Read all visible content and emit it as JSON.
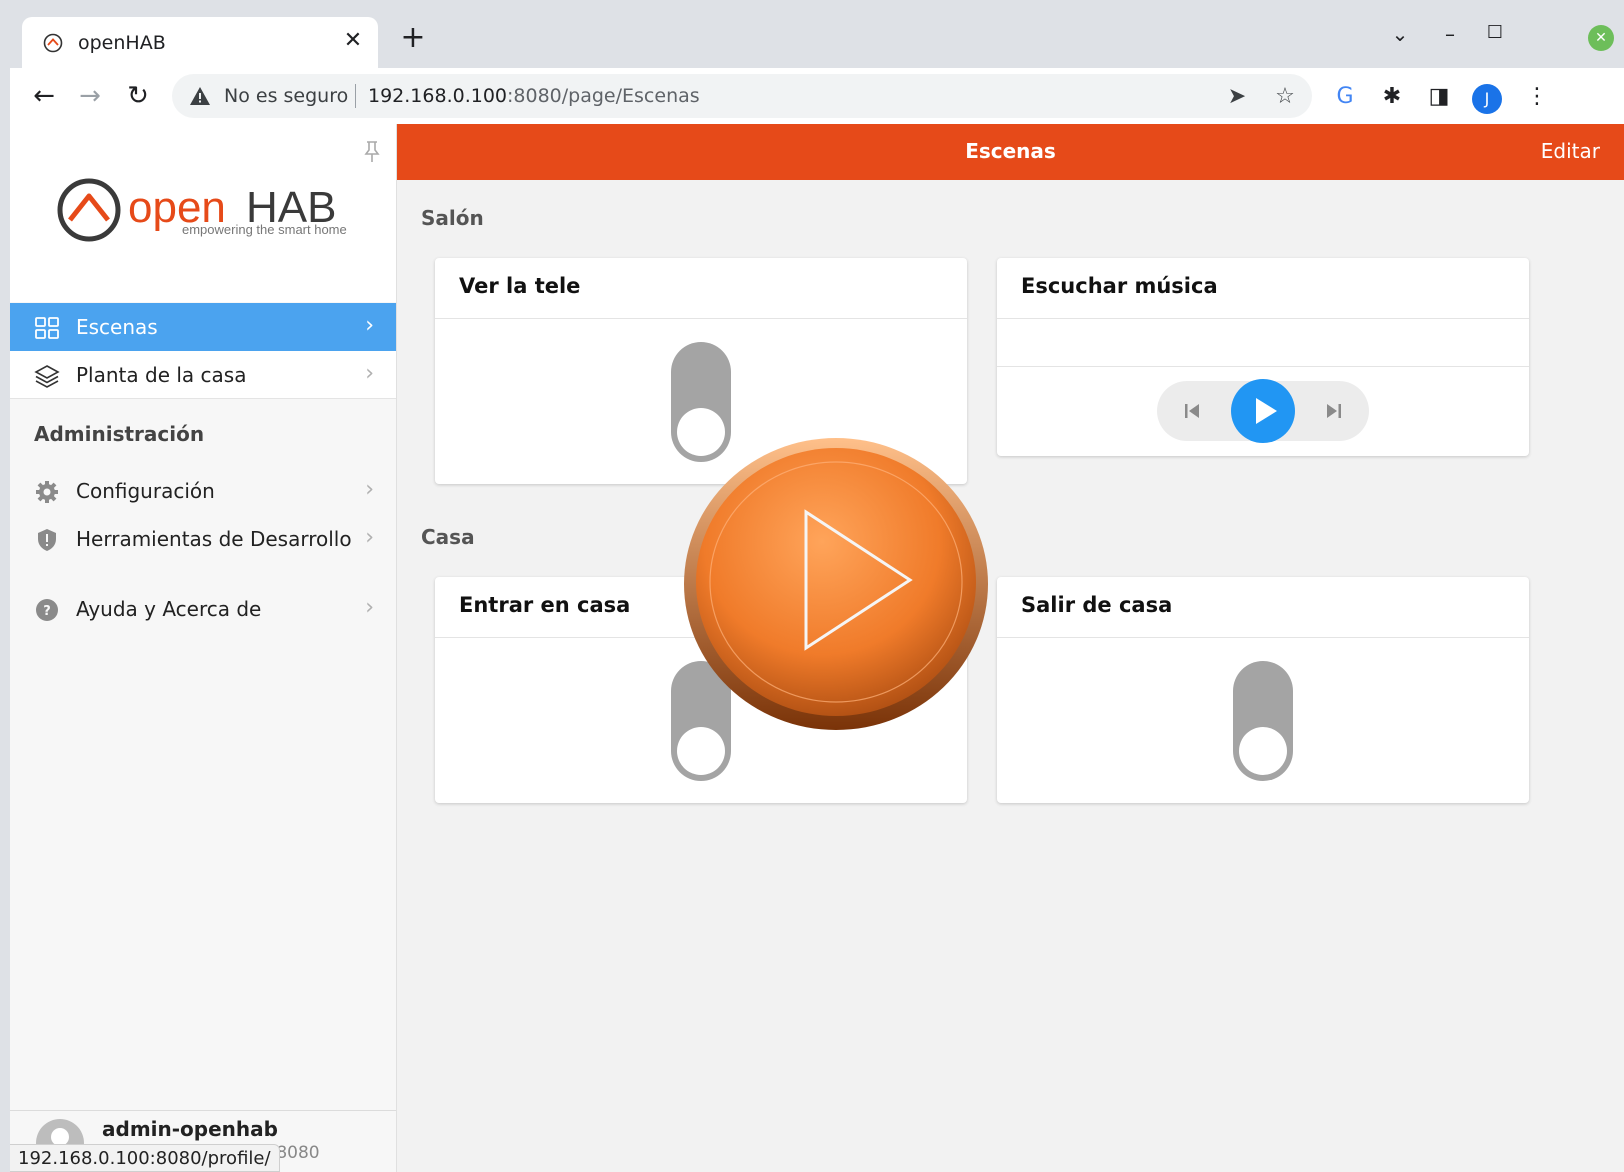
{
  "browser": {
    "tab_title": "openHAB",
    "tab_close": "✕",
    "new_tab": "+",
    "insecure_label": "No es seguro",
    "url_host": "192.168.0.100",
    "url_rest": ":8080/page/Escenas",
    "profile_initial": "J",
    "status_url": "192.168.0.100:8080/profile/"
  },
  "sidebar": {
    "logo_text_open": "open",
    "logo_text_hab": "HAB",
    "logo_tagline": "empowering the smart home",
    "items": [
      {
        "label": "Escenas"
      },
      {
        "label": "Planta de la casa"
      }
    ],
    "admin_title": "Administración",
    "admin_items": [
      {
        "label": "Configuración"
      },
      {
        "label": "Herramientas de Desarrollo"
      }
    ],
    "help_item": {
      "label": "Ayuda y Acerca de"
    },
    "user": {
      "name": "admin-openhab",
      "sub": "):8080"
    }
  },
  "navbar": {
    "title": "Escenas",
    "edit": "Editar"
  },
  "sections": [
    {
      "title": "Salón",
      "cards": [
        {
          "title": "Ver la tele",
          "type": "toggle",
          "state": "off"
        },
        {
          "title": "Escuchar música",
          "type": "player"
        }
      ]
    },
    {
      "title": "Casa",
      "cards": [
        {
          "title": "Entrar en casa",
          "type": "toggle",
          "state": "off"
        },
        {
          "title": "Salir de casa",
          "type": "toggle",
          "state": "off"
        }
      ]
    }
  ],
  "colors": {
    "navbar": "#e64a19",
    "active_menu": "#4ba3ef",
    "play_button": "#2196f3",
    "toggle_off": "#a4a4a4",
    "overlay_orange": "#f07b2a"
  },
  "icons": {
    "overlay": "play-overlay-icon"
  }
}
